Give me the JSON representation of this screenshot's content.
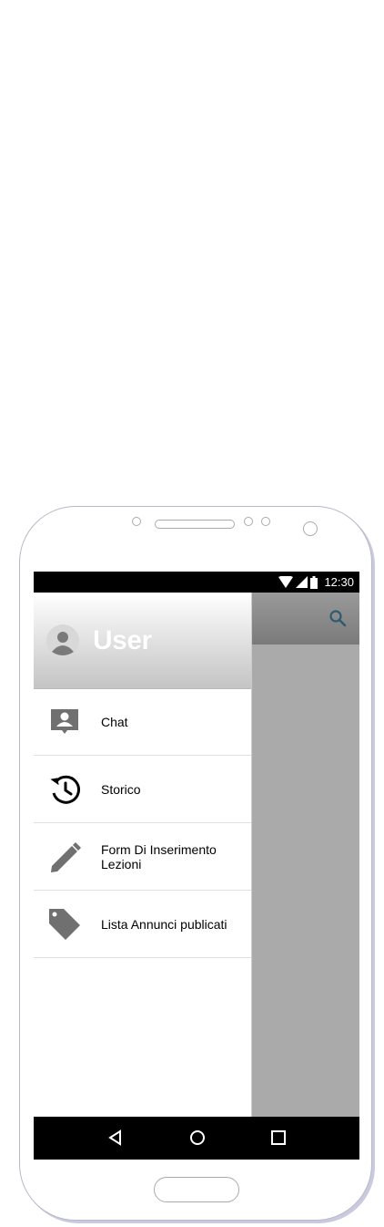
{
  "status_bar": {
    "time": "12:30"
  },
  "drawer": {
    "user_name": "User",
    "items": [
      {
        "label": "Chat",
        "icon": "chat-person-icon"
      },
      {
        "label": "Storico",
        "icon": "history-icon"
      },
      {
        "label": "Form Di Inserimento Lezioni",
        "icon": "pencil-icon"
      },
      {
        "label": "Lista Annunci publicati",
        "icon": "tag-icon"
      }
    ]
  },
  "colors": {
    "app_bar": "#888888",
    "scrim": "#aaaaaa",
    "status_bar": "#000000",
    "nav_bar": "#000000",
    "search_icon": "#2e5b6e"
  }
}
